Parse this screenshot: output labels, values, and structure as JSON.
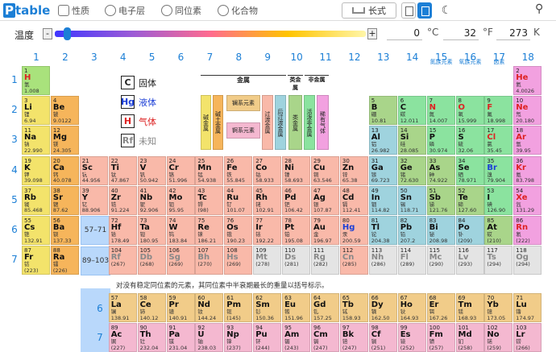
{
  "header": {
    "logo_p": "P",
    "logo_t": "table",
    "tabs": [
      {
        "label": "性质",
        "icon": "list-icon"
      },
      {
        "label": "电子层",
        "icon": "atom-icon"
      },
      {
        "label": "同位素",
        "icon": "isotope-icon"
      },
      {
        "label": "化合物",
        "icon": "compound-icon"
      }
    ],
    "view_long": "长式",
    "search_icon": "search-icon",
    "theme_icon": "moon-icon"
  },
  "temperature": {
    "label": "温度",
    "minus": "-",
    "plus": "+",
    "value_k": "0",
    "unit_c": "°C",
    "value_f": "32",
    "unit_f": "°F",
    "value_kelvin": "273",
    "unit_k": "K",
    "position": 0.04
  },
  "groups": [
    "1",
    "2",
    "3",
    "4",
    "5",
    "6",
    "7",
    "8",
    "9",
    "10",
    "11",
    "12",
    "13",
    "14",
    "15",
    "16",
    "17",
    "18"
  ],
  "group_subs": {
    "15": "氮族元素",
    "16": "氧族元素",
    "17": "卤素"
  },
  "periods": [
    "1",
    "2",
    "3",
    "4",
    "5",
    "6",
    "7"
  ],
  "legend": [
    {
      "sym": "C",
      "label": "固体",
      "cls": "sol"
    },
    {
      "sym": "Hg",
      "label": "液体",
      "cls": "liq"
    },
    {
      "sym": "H",
      "label": "气体",
      "cls": "gas"
    },
    {
      "sym": "Rf",
      "label": "未知",
      "cls": "unk"
    }
  ],
  "categories": {
    "metal": "金属",
    "metalloid": "类金属",
    "nonmetal": "非金属",
    "alkali": "碱金属",
    "alkaline": "碱土金属",
    "lanthanide": "镧系元素",
    "actinide": "锕系元素",
    "transition": "过渡金属",
    "post": "后过渡金属",
    "reactive": "活泼非金属",
    "noble": "稀有气体"
  },
  "refs": {
    "la": "57–71",
    "ac": "89–103",
    "la_p": "6",
    "ac_p": "7"
  },
  "note": "对没有稳定同位素的元素，其同位素中半衰期最长的重量以括号标示。",
  "colors": {
    "alkali": "#f3e36b",
    "alkaline": "#f6b55b",
    "transition": "#f9b9a9",
    "post": "#9fd3de",
    "metalloid": "#a9d58a",
    "reactive": "#8be39f",
    "noble": "#f2a1e0",
    "lanthanide": "#f1cc89",
    "actinide": "#f4b8d0",
    "unknown": "#e4e4e4",
    "h": "#a9e27c"
  },
  "elements": [
    {
      "z": "1",
      "s": "H",
      "n": "氢",
      "m": "1.008",
      "c": "reactive",
      "g": 1,
      "p": 1,
      "st": "gas"
    },
    {
      "z": "2",
      "s": "He",
      "n": "氦",
      "m": "4.0026",
      "c": "noble",
      "g": 18,
      "p": 1,
      "st": "gas"
    },
    {
      "z": "3",
      "s": "Li",
      "n": "锂",
      "m": "6.94",
      "c": "alkali",
      "g": 1,
      "p": 2
    },
    {
      "z": "4",
      "s": "Be",
      "n": "铍",
      "m": "9.0122",
      "c": "alkaline",
      "g": 2,
      "p": 2
    },
    {
      "z": "5",
      "s": "B",
      "n": "硼",
      "m": "10.81",
      "c": "metalloid",
      "g": 13,
      "p": 2
    },
    {
      "z": "6",
      "s": "C",
      "n": "碳",
      "m": "12.011",
      "c": "reactive",
      "g": 14,
      "p": 2
    },
    {
      "z": "7",
      "s": "N",
      "n": "氮",
      "m": "14.007",
      "c": "reactive",
      "g": 15,
      "p": 2,
      "st": "gas"
    },
    {
      "z": "8",
      "s": "O",
      "n": "氧",
      "m": "15.999",
      "c": "reactive",
      "g": 16,
      "p": 2,
      "st": "gas"
    },
    {
      "z": "9",
      "s": "F",
      "n": "氟",
      "m": "18.998",
      "c": "reactive",
      "g": 17,
      "p": 2,
      "st": "gas"
    },
    {
      "z": "10",
      "s": "Ne",
      "n": "氖",
      "m": "20.180",
      "c": "noble",
      "g": 18,
      "p": 2,
      "st": "gas"
    },
    {
      "z": "11",
      "s": "Na",
      "n": "钠",
      "m": "22.990",
      "c": "alkali",
      "g": 1,
      "p": 3
    },
    {
      "z": "12",
      "s": "Mg",
      "n": "镁",
      "m": "24.305",
      "c": "alkaline",
      "g": 2,
      "p": 3
    },
    {
      "z": "13",
      "s": "Al",
      "n": "铝",
      "m": "26.982",
      "c": "post",
      "g": 13,
      "p": 3
    },
    {
      "z": "14",
      "s": "Si",
      "n": "硅",
      "m": "28.085",
      "c": "metalloid",
      "g": 14,
      "p": 3
    },
    {
      "z": "15",
      "s": "P",
      "n": "磷",
      "m": "30.974",
      "c": "reactive",
      "g": 15,
      "p": 3
    },
    {
      "z": "16",
      "s": "S",
      "n": "硫",
      "m": "32.06",
      "c": "reactive",
      "g": 16,
      "p": 3
    },
    {
      "z": "17",
      "s": "Cl",
      "n": "氯",
      "m": "35.45",
      "c": "reactive",
      "g": 17,
      "p": 3,
      "st": "gas"
    },
    {
      "z": "18",
      "s": "Ar",
      "n": "氩",
      "m": "39.95",
      "c": "noble",
      "g": 18,
      "p": 3,
      "st": "gas"
    },
    {
      "z": "19",
      "s": "K",
      "n": "钾",
      "m": "39.098",
      "c": "alkali",
      "g": 1,
      "p": 4
    },
    {
      "z": "20",
      "s": "Ca",
      "n": "钙",
      "m": "40.078",
      "c": "alkaline",
      "g": 2,
      "p": 4
    },
    {
      "z": "21",
      "s": "Sc",
      "n": "钪",
      "m": "44.956",
      "c": "transition",
      "g": 3,
      "p": 4
    },
    {
      "z": "22",
      "s": "Ti",
      "n": "钛",
      "m": "47.867",
      "c": "transition",
      "g": 4,
      "p": 4
    },
    {
      "z": "23",
      "s": "V",
      "n": "钒",
      "m": "50.942",
      "c": "transition",
      "g": 5,
      "p": 4
    },
    {
      "z": "24",
      "s": "Cr",
      "n": "铬",
      "m": "51.996",
      "c": "transition",
      "g": 6,
      "p": 4
    },
    {
      "z": "25",
      "s": "Mn",
      "n": "锰",
      "m": "54.938",
      "c": "transition",
      "g": 7,
      "p": 4
    },
    {
      "z": "26",
      "s": "Fe",
      "n": "铁",
      "m": "55.845",
      "c": "transition",
      "g": 8,
      "p": 4
    },
    {
      "z": "27",
      "s": "Co",
      "n": "钴",
      "m": "58.933",
      "c": "transition",
      "g": 9,
      "p": 4
    },
    {
      "z": "28",
      "s": "Ni",
      "n": "镍",
      "m": "58.693",
      "c": "transition",
      "g": 10,
      "p": 4
    },
    {
      "z": "29",
      "s": "Cu",
      "n": "铜",
      "m": "63.546",
      "c": "transition",
      "g": 11,
      "p": 4
    },
    {
      "z": "30",
      "s": "Zn",
      "n": "锌",
      "m": "65.38",
      "c": "transition",
      "g": 12,
      "p": 4
    },
    {
      "z": "31",
      "s": "Ga",
      "n": "镓",
      "m": "69.723",
      "c": "post",
      "g": 13,
      "p": 4
    },
    {
      "z": "32",
      "s": "Ge",
      "n": "锗",
      "m": "72.630",
      "c": "metalloid",
      "g": 14,
      "p": 4
    },
    {
      "z": "33",
      "s": "As",
      "n": "砷",
      "m": "74.922",
      "c": "metalloid",
      "g": 15,
      "p": 4
    },
    {
      "z": "34",
      "s": "Se",
      "n": "硒",
      "m": "78.971",
      "c": "reactive",
      "g": 16,
      "p": 4
    },
    {
      "z": "35",
      "s": "Br",
      "n": "溴",
      "m": "79.904",
      "c": "reactive",
      "g": 17,
      "p": 4,
      "st": "liq"
    },
    {
      "z": "36",
      "s": "Kr",
      "n": "氪",
      "m": "83.798",
      "c": "noble",
      "g": 18,
      "p": 4,
      "st": "gas"
    },
    {
      "z": "37",
      "s": "Rb",
      "n": "铷",
      "m": "85.468",
      "c": "alkali",
      "g": 1,
      "p": 5
    },
    {
      "z": "38",
      "s": "Sr",
      "n": "锶",
      "m": "87.62",
      "c": "alkaline",
      "g": 2,
      "p": 5
    },
    {
      "z": "39",
      "s": "Y",
      "n": "钇",
      "m": "88.906",
      "c": "transition",
      "g": 3,
      "p": 5
    },
    {
      "z": "40",
      "s": "Zr",
      "n": "锆",
      "m": "91.224",
      "c": "transition",
      "g": 4,
      "p": 5
    },
    {
      "z": "41",
      "s": "Nb",
      "n": "铌",
      "m": "92.906",
      "c": "transition",
      "g": 5,
      "p": 5
    },
    {
      "z": "42",
      "s": "Mo",
      "n": "钼",
      "m": "95.95",
      "c": "transition",
      "g": 6,
      "p": 5
    },
    {
      "z": "43",
      "s": "Tc",
      "n": "锝",
      "m": "(98)",
      "c": "transition",
      "g": 7,
      "p": 5
    },
    {
      "z": "44",
      "s": "Ru",
      "n": "钌",
      "m": "101.07",
      "c": "transition",
      "g": 8,
      "p": 5
    },
    {
      "z": "45",
      "s": "Rh",
      "n": "铑",
      "m": "102.91",
      "c": "transition",
      "g": 9,
      "p": 5
    },
    {
      "z": "46",
      "s": "Pd",
      "n": "钯",
      "m": "106.42",
      "c": "transition",
      "g": 10,
      "p": 5
    },
    {
      "z": "47",
      "s": "Ag",
      "n": "银",
      "m": "107.87",
      "c": "transition",
      "g": 11,
      "p": 5
    },
    {
      "z": "48",
      "s": "Cd",
      "n": "镉",
      "m": "112.41",
      "c": "transition",
      "g": 12,
      "p": 5
    },
    {
      "z": "49",
      "s": "In",
      "n": "铟",
      "m": "114.82",
      "c": "post",
      "g": 13,
      "p": 5
    },
    {
      "z": "50",
      "s": "Sn",
      "n": "锡",
      "m": "118.71",
      "c": "post",
      "g": 14,
      "p": 5
    },
    {
      "z": "51",
      "s": "Sb",
      "n": "锑",
      "m": "121.76",
      "c": "metalloid",
      "g": 15,
      "p": 5
    },
    {
      "z": "52",
      "s": "Te",
      "n": "碲",
      "m": "127.60",
      "c": "metalloid",
      "g": 16,
      "p": 5
    },
    {
      "z": "53",
      "s": "I",
      "n": "碘",
      "m": "126.90",
      "c": "reactive",
      "g": 17,
      "p": 5
    },
    {
      "z": "54",
      "s": "Xe",
      "n": "氙",
      "m": "131.29",
      "c": "noble",
      "g": 18,
      "p": 5,
      "st": "gas"
    },
    {
      "z": "55",
      "s": "Cs",
      "n": "铯",
      "m": "132.91",
      "c": "alkali",
      "g": 1,
      "p": 6
    },
    {
      "z": "56",
      "s": "Ba",
      "n": "钡",
      "m": "137.33",
      "c": "alkaline",
      "g": 2,
      "p": 6
    },
    {
      "z": "72",
      "s": "Hf",
      "n": "铪",
      "m": "178.49",
      "c": "transition",
      "g": 4,
      "p": 6
    },
    {
      "z": "73",
      "s": "Ta",
      "n": "钽",
      "m": "180.95",
      "c": "transition",
      "g": 5,
      "p": 6
    },
    {
      "z": "74",
      "s": "W",
      "n": "钨",
      "m": "183.84",
      "c": "transition",
      "g": 6,
      "p": 6
    },
    {
      "z": "75",
      "s": "Re",
      "n": "铼",
      "m": "186.21",
      "c": "transition",
      "g": 7,
      "p": 6
    },
    {
      "z": "76",
      "s": "Os",
      "n": "锇",
      "m": "190.23",
      "c": "transition",
      "g": 8,
      "p": 6
    },
    {
      "z": "77",
      "s": "Ir",
      "n": "铱",
      "m": "192.22",
      "c": "transition",
      "g": 9,
      "p": 6
    },
    {
      "z": "78",
      "s": "Pt",
      "n": "铂",
      "m": "195.08",
      "c": "transition",
      "g": 10,
      "p": 6
    },
    {
      "z": "79",
      "s": "Au",
      "n": "金",
      "m": "196.97",
      "c": "transition",
      "g": 11,
      "p": 6
    },
    {
      "z": "80",
      "s": "Hg",
      "n": "汞",
      "m": "200.59",
      "c": "transition",
      "g": 12,
      "p": 6,
      "st": "liq"
    },
    {
      "z": "81",
      "s": "Tl",
      "n": "铊",
      "m": "204.38",
      "c": "post",
      "g": 13,
      "p": 6
    },
    {
      "z": "82",
      "s": "Pb",
      "n": "铅",
      "m": "207.2",
      "c": "post",
      "g": 14,
      "p": 6
    },
    {
      "z": "83",
      "s": "Bi",
      "n": "铋",
      "m": "208.98",
      "c": "post",
      "g": 15,
      "p": 6
    },
    {
      "z": "84",
      "s": "Po",
      "n": "钋",
      "m": "(209)",
      "c": "post",
      "g": 16,
      "p": 6
    },
    {
      "z": "85",
      "s": "At",
      "n": "砹",
      "m": "(210)",
      "c": "metalloid",
      "g": 17,
      "p": 6
    },
    {
      "z": "86",
      "s": "Rn",
      "n": "氡",
      "m": "(222)",
      "c": "noble",
      "g": 18,
      "p": 6,
      "st": "gas"
    },
    {
      "z": "87",
      "s": "Fr",
      "n": "钫",
      "m": "(223)",
      "c": "alkali",
      "g": 1,
      "p": 7
    },
    {
      "z": "88",
      "s": "Ra",
      "n": "镭",
      "m": "(226)",
      "c": "alkaline",
      "g": 2,
      "p": 7
    },
    {
      "z": "104",
      "s": "Rf",
      "n": "",
      "m": "(267)",
      "c": "transition",
      "g": 4,
      "p": 7,
      "st": "unk"
    },
    {
      "z": "105",
      "s": "Db",
      "n": "",
      "m": "(268)",
      "c": "transition",
      "g": 5,
      "p": 7,
      "st": "unk"
    },
    {
      "z": "106",
      "s": "Sg",
      "n": "",
      "m": "(269)",
      "c": "transition",
      "g": 6,
      "p": 7,
      "st": "unk"
    },
    {
      "z": "107",
      "s": "Bh",
      "n": "",
      "m": "(270)",
      "c": "transition",
      "g": 7,
      "p": 7,
      "st": "unk"
    },
    {
      "z": "108",
      "s": "Hs",
      "n": "",
      "m": "(269)",
      "c": "transition",
      "g": 8,
      "p": 7,
      "st": "unk"
    },
    {
      "z": "109",
      "s": "Mt",
      "n": "",
      "m": "(278)",
      "c": "unknown",
      "g": 9,
      "p": 7,
      "st": "unk"
    },
    {
      "z": "110",
      "s": "Ds",
      "n": "",
      "m": "(281)",
      "c": "unknown",
      "g": 10,
      "p": 7,
      "st": "unk"
    },
    {
      "z": "111",
      "s": "Rg",
      "n": "",
      "m": "(282)",
      "c": "unknown",
      "g": 11,
      "p": 7,
      "st": "unk"
    },
    {
      "z": "112",
      "s": "Cn",
      "n": "",
      "m": "(285)",
      "c": "transition",
      "g": 12,
      "p": 7,
      "st": "unk"
    },
    {
      "z": "113",
      "s": "Nh",
      "n": "",
      "m": "(286)",
      "c": "unknown",
      "g": 13,
      "p": 7,
      "st": "unk"
    },
    {
      "z": "114",
      "s": "Fl",
      "n": "",
      "m": "(289)",
      "c": "unknown",
      "g": 14,
      "p": 7,
      "st": "unk"
    },
    {
      "z": "115",
      "s": "Mc",
      "n": "",
      "m": "(290)",
      "c": "unknown",
      "g": 15,
      "p": 7,
      "st": "unk"
    },
    {
      "z": "116",
      "s": "Lv",
      "n": "",
      "m": "(293)",
      "c": "unknown",
      "g": 16,
      "p": 7,
      "st": "unk"
    },
    {
      "z": "117",
      "s": "Ts",
      "n": "",
      "m": "(294)",
      "c": "unknown",
      "g": 17,
      "p": 7,
      "st": "unk"
    },
    {
      "z": "118",
      "s": "Og",
      "n": "",
      "m": "(294)",
      "c": "unknown",
      "g": 18,
      "p": 7,
      "st": "unk"
    },
    {
      "z": "57",
      "s": "La",
      "n": "镧",
      "m": "138.91",
      "c": "lanthanide",
      "g": 4,
      "p": 8
    },
    {
      "z": "58",
      "s": "Ce",
      "n": "铈",
      "m": "140.12",
      "c": "lanthanide",
      "g": 5,
      "p": 8
    },
    {
      "z": "59",
      "s": "Pr",
      "n": "镨",
      "m": "140.91",
      "c": "lanthanide",
      "g": 6,
      "p": 8
    },
    {
      "z": "60",
      "s": "Nd",
      "n": "钕",
      "m": "144.24",
      "c": "lanthanide",
      "g": 7,
      "p": 8
    },
    {
      "z": "61",
      "s": "Pm",
      "n": "钷",
      "m": "(145)",
      "c": "lanthanide",
      "g": 8,
      "p": 8
    },
    {
      "z": "62",
      "s": "Sm",
      "n": "钐",
      "m": "150.36",
      "c": "lanthanide",
      "g": 9,
      "p": 8
    },
    {
      "z": "63",
      "s": "Eu",
      "n": "铕",
      "m": "151.96",
      "c": "lanthanide",
      "g": 10,
      "p": 8
    },
    {
      "z": "64",
      "s": "Gd",
      "n": "钆",
      "m": "157.25",
      "c": "lanthanide",
      "g": 11,
      "p": 8
    },
    {
      "z": "65",
      "s": "Tb",
      "n": "铽",
      "m": "158.93",
      "c": "lanthanide",
      "g": 12,
      "p": 8
    },
    {
      "z": "66",
      "s": "Dy",
      "n": "镝",
      "m": "162.50",
      "c": "lanthanide",
      "g": 13,
      "p": 8
    },
    {
      "z": "67",
      "s": "Ho",
      "n": "钬",
      "m": "164.93",
      "c": "lanthanide",
      "g": 14,
      "p": 8
    },
    {
      "z": "68",
      "s": "Er",
      "n": "铒",
      "m": "167.26",
      "c": "lanthanide",
      "g": 15,
      "p": 8
    },
    {
      "z": "69",
      "s": "Tm",
      "n": "铥",
      "m": "168.93",
      "c": "lanthanide",
      "g": 16,
      "p": 8
    },
    {
      "z": "70",
      "s": "Yb",
      "n": "镱",
      "m": "173.05",
      "c": "lanthanide",
      "g": 17,
      "p": 8
    },
    {
      "z": "71",
      "s": "Lu",
      "n": "镥",
      "m": "174.97",
      "c": "lanthanide",
      "g": 18,
      "p": 8
    },
    {
      "z": "89",
      "s": "Ac",
      "n": "锕",
      "m": "(227)",
      "c": "actinide",
      "g": 4,
      "p": 9
    },
    {
      "z": "90",
      "s": "Th",
      "n": "钍",
      "m": "232.04",
      "c": "actinide",
      "g": 5,
      "p": 9
    },
    {
      "z": "91",
      "s": "Pa",
      "n": "镤",
      "m": "231.04",
      "c": "actinide",
      "g": 6,
      "p": 9
    },
    {
      "z": "92",
      "s": "U",
      "n": "铀",
      "m": "238.03",
      "c": "actinide",
      "g": 7,
      "p": 9
    },
    {
      "z": "93",
      "s": "Np",
      "n": "镎",
      "m": "(237)",
      "c": "actinide",
      "g": 8,
      "p": 9
    },
    {
      "z": "94",
      "s": "Pu",
      "n": "钚",
      "m": "(244)",
      "c": "actinide",
      "g": 9,
      "p": 9
    },
    {
      "z": "95",
      "s": "Am",
      "n": "镅",
      "m": "(243)",
      "c": "actinide",
      "g": 10,
      "p": 9
    },
    {
      "z": "96",
      "s": "Cm",
      "n": "锔",
      "m": "(247)",
      "c": "actinide",
      "g": 11,
      "p": 9
    },
    {
      "z": "97",
      "s": "Bk",
      "n": "锫",
      "m": "(247)",
      "c": "actinide",
      "g": 12,
      "p": 9
    },
    {
      "z": "98",
      "s": "Cf",
      "n": "锎",
      "m": "(251)",
      "c": "actinide",
      "g": 13,
      "p": 9
    },
    {
      "z": "99",
      "s": "Es",
      "n": "锿",
      "m": "(252)",
      "c": "actinide",
      "g": 14,
      "p": 9
    },
    {
      "z": "100",
      "s": "Fm",
      "n": "镄",
      "m": "(257)",
      "c": "actinide",
      "g": 15,
      "p": 9
    },
    {
      "z": "101",
      "s": "Md",
      "n": "钔",
      "m": "(258)",
      "c": "actinide",
      "g": 16,
      "p": 9
    },
    {
      "z": "102",
      "s": "No",
      "n": "锘",
      "m": "(259)",
      "c": "actinide",
      "g": 17,
      "p": 9
    },
    {
      "z": "103",
      "s": "Lr",
      "n": "铹",
      "m": "(266)",
      "c": "actinide",
      "g": 18,
      "p": 9
    }
  ]
}
